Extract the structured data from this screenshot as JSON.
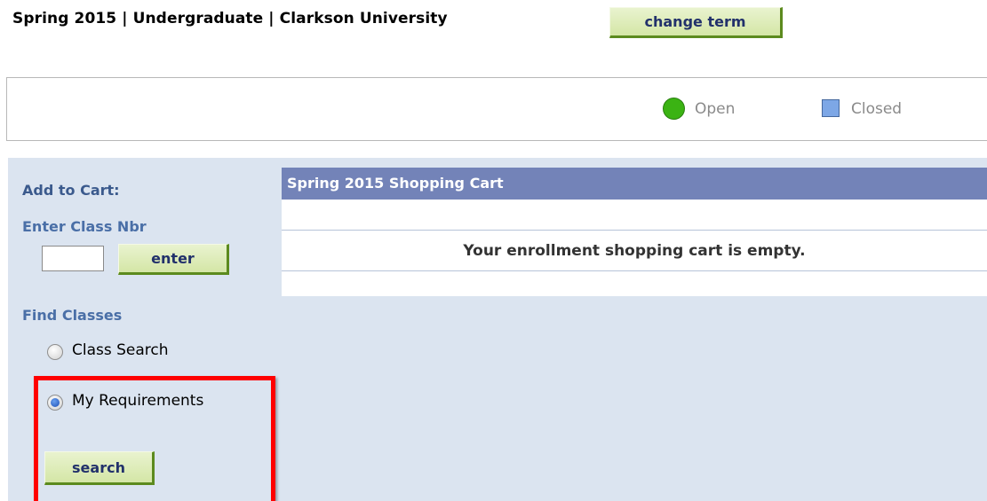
{
  "header": {
    "term_text": "Spring 2015 | Undergraduate | Clarkson University",
    "change_term_label": "change term"
  },
  "legend": {
    "open_label": "Open",
    "open_color": "#3bb313",
    "closed_label": "Closed",
    "closed_color": "#7da7e6"
  },
  "sidebar": {
    "add_to_cart_label": "Add to Cart:",
    "enter_class_nbr_label": "Enter Class Nbr",
    "class_nbr_value": "",
    "enter_button_label": "enter",
    "find_classes_label": "Find Classes",
    "radio_options": [
      {
        "label": "Class Search",
        "checked": false
      },
      {
        "label": "My Requirements",
        "checked": true
      }
    ],
    "search_button_label": "search"
  },
  "cart": {
    "title": "Spring 2015 Shopping Cart",
    "empty_message": "Your enrollment shopping cart is empty.",
    "header_color": "#7383b8"
  },
  "annotation": {
    "highlight_color": "#ff0000"
  }
}
